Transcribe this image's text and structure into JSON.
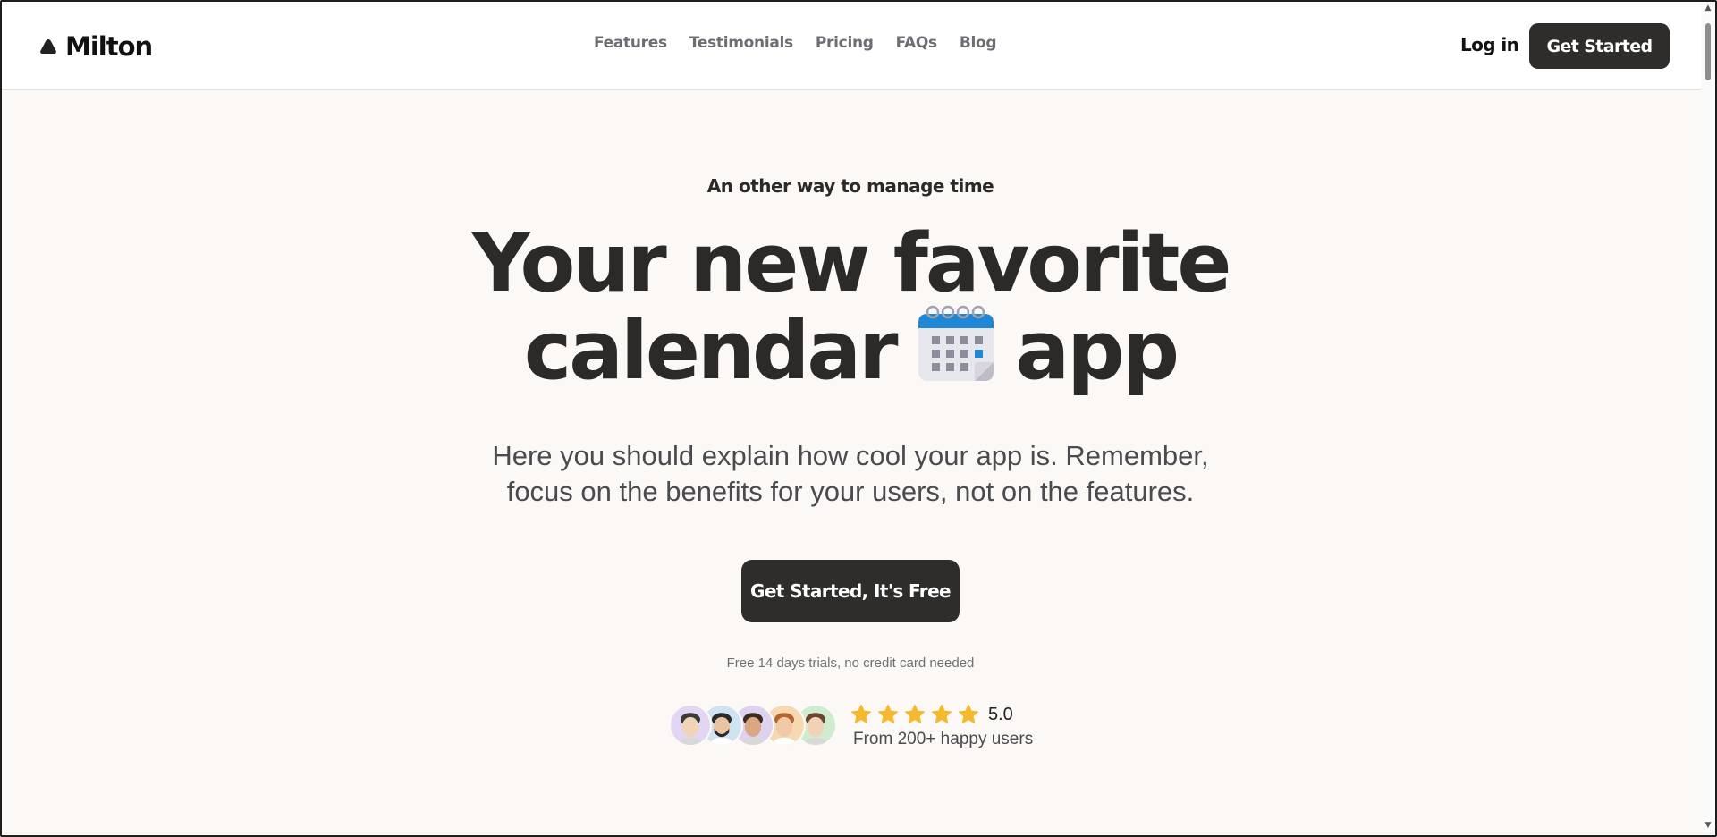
{
  "brand": {
    "name": "Milton"
  },
  "nav": {
    "links": [
      {
        "label": "Features"
      },
      {
        "label": "Testimonials"
      },
      {
        "label": "Pricing"
      },
      {
        "label": "FAQs"
      },
      {
        "label": "Blog"
      }
    ],
    "login_label": "Log in",
    "cta_label": "Get Started"
  },
  "hero": {
    "eyebrow": "An other way to manage time",
    "headline_line1": "Your new favorite",
    "headline_line2_start": "calendar",
    "headline_icon": "calendar-icon",
    "headline_line2_end": "app",
    "subtext": "Here you should explain how cool your app is. Remember, focus on the benefits for your users, not on the features.",
    "cta_label": "Get Started, It's Free",
    "note": "Free 14 days trials, no credit card needed"
  },
  "social_proof": {
    "avatar_count": 5,
    "avatar_colors": [
      "#e3d6f2",
      "#cfe3f2",
      "#ddd2f0",
      "#f6d9b0",
      "#cfeccf"
    ],
    "stars": 5,
    "rating": "5.0",
    "users_label": "From 200+ happy users"
  },
  "colors": {
    "background": "#fcf8f5",
    "header_bg": "#ffffff",
    "dark_button": "#2e2d2b",
    "text": "#2b2a28",
    "nav_text": "#6b6e73",
    "star": "#f5b92e",
    "calendar_blue": "#1f87d6"
  }
}
